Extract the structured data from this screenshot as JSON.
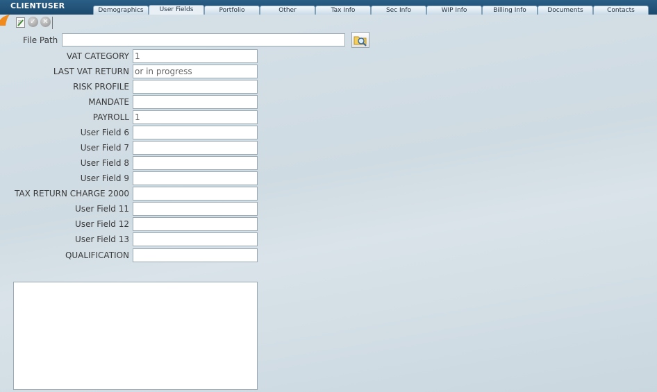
{
  "app": {
    "title": "CLIENTUSER"
  },
  "tabs": [
    {
      "label": "Demographics"
    },
    {
      "label": "User Fields"
    },
    {
      "label": "Portfolio"
    },
    {
      "label": "Other"
    },
    {
      "label": "Tax Info"
    },
    {
      "label": "Sec Info"
    },
    {
      "label": "WIP Info"
    },
    {
      "label": "Billing Info"
    },
    {
      "label": "Documents"
    },
    {
      "label": "Contacts"
    }
  ],
  "active_tab": "User Fields",
  "toolbar": {
    "icons": [
      "edit-icon",
      "save-check-icon",
      "cancel-icon"
    ]
  },
  "file_path": {
    "label": "File Path",
    "value": ""
  },
  "fields": [
    {
      "label": "VAT CATEGORY",
      "value": "1"
    },
    {
      "label": "LAST VAT RETURN",
      "value": "or in progress"
    },
    {
      "label": "RISK PROFILE",
      "value": ""
    },
    {
      "label": "MANDATE",
      "value": ""
    },
    {
      "label": "PAYROLL",
      "value": "1"
    },
    {
      "label": "User Field 6",
      "value": ""
    },
    {
      "label": "User Field 7",
      "value": ""
    },
    {
      "label": "User Field 8",
      "value": ""
    },
    {
      "label": "User Field 9",
      "value": ""
    },
    {
      "label": "TAX RETURN CHARGE 2000",
      "value": ""
    },
    {
      "label": "User Field 11",
      "value": ""
    },
    {
      "label": "User Field 12",
      "value": ""
    },
    {
      "label": "User Field 13",
      "value": ""
    },
    {
      "label": "QUALIFICATION",
      "value": ""
    }
  ],
  "notes": {
    "value": ""
  },
  "colors": {
    "titlebar": "#1c4a6e",
    "accent": "#f08a1c",
    "background": "#d3dee5"
  }
}
